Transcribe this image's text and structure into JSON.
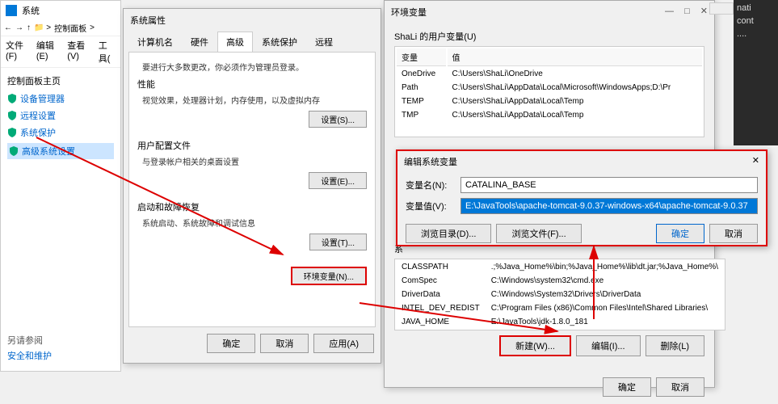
{
  "win1": {
    "title": "系统",
    "breadcrumb": "控制面板",
    "menu": [
      "文件(F)",
      "编辑(E)",
      "查看(V)",
      "工具("
    ],
    "homeTitle": "控制面板主页",
    "links": [
      {
        "label": "设备管理器"
      },
      {
        "label": "远程设置"
      },
      {
        "label": "系统保护"
      },
      {
        "label": "高级系统设置"
      }
    ],
    "footerTitle": "另请参阅",
    "footerLink": "安全和维护"
  },
  "win2": {
    "title": "系统属性",
    "tabs": [
      "计算机名",
      "硬件",
      "高级",
      "系统保护",
      "远程"
    ],
    "activeTab": 2,
    "adminNote": "要进行大多数更改，你必须作为管理员登录。",
    "sections": [
      {
        "title": "性能",
        "desc": "视觉效果，处理器计划，内存使用，以及虚拟内存",
        "btn": "设置(S)..."
      },
      {
        "title": "用户配置文件",
        "desc": "与登录帐户相关的桌面设置",
        "btn": "设置(E)..."
      },
      {
        "title": "启动和故障恢复",
        "desc": "系统启动、系统故障和调试信息",
        "btn": "设置(T)..."
      }
    ],
    "envBtn": "环境变量(N)...",
    "ok": "确定",
    "cancel": "取消",
    "apply": "应用(A)"
  },
  "win3": {
    "title": "环境变量",
    "userLabel": "ShaLi 的用户变量(U)",
    "cols": [
      "变量",
      "值"
    ],
    "userVars": [
      {
        "n": "OneDrive",
        "v": "C:\\Users\\ShaLi\\OneDrive"
      },
      {
        "n": "Path",
        "v": "C:\\Users\\ShaLi\\AppData\\Local\\Microsoft\\WindowsApps;D:\\Pr"
      },
      {
        "n": "TEMP",
        "v": "C:\\Users\\ShaLi\\AppData\\Local\\Temp"
      },
      {
        "n": "TMP",
        "v": "C:\\Users\\ShaLi\\AppData\\Local\\Temp"
      }
    ],
    "sysLabel": "系",
    "sysVars": [
      {
        "n": "CLASSPATH",
        "v": ".;%Java_Home%\\bin;%Java_Home%\\lib\\dt.jar;%Java_Home%\\"
      },
      {
        "n": "ComSpec",
        "v": "C:\\Windows\\system32\\cmd.exe"
      },
      {
        "n": "DriverData",
        "v": "C:\\Windows\\System32\\Drivers\\DriverData"
      },
      {
        "n": "INTEL_DEV_REDIST",
        "v": "C:\\Program Files (x86)\\Common Files\\Intel\\Shared Libraries\\"
      },
      {
        "n": "JAVA_HOME",
        "v": "E:\\JavaTools\\jdk-1.8.0_181"
      }
    ],
    "newBtn": "新建(W)...",
    "editBtn": "编辑(I)...",
    "delBtn": "删除(L)",
    "ok": "确定",
    "cancel": "取消"
  },
  "win4": {
    "title": "编辑系统变量",
    "nameLabel": "变量名(N):",
    "nameValue": "CATALINA_BASE",
    "valueLabel": "变量值(V):",
    "valueValue": "E:\\JavaTools\\apache-tomcat-9.0.37-windows-x64\\apache-tomcat-9.0.37",
    "browseDir": "浏览目录(D)...",
    "browseFile": "浏览文件(F)...",
    "ok": "确定",
    "cancel": "取消"
  }
}
